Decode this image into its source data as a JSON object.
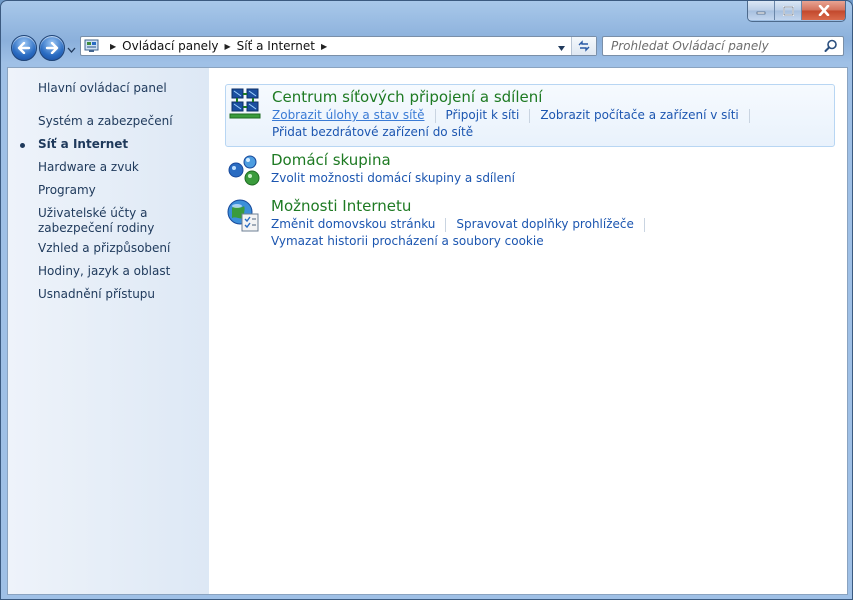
{
  "window": {
    "caption_buttons": [
      "minimize-icon",
      "maximize-icon",
      "close-icon"
    ]
  },
  "navigation": {
    "breadcrumbs": [
      "Ovládací panely",
      "Síť a Internet"
    ],
    "search_placeholder": "Prohledat Ovládací panely"
  },
  "sidebar": {
    "home": "Hlavní ovládací panel",
    "items": [
      "Systém a zabezpečení",
      "Síť a Internet",
      "Hardware a zvuk",
      "Programy",
      "Uživatelské účty a zabezpečení rodiny",
      "Vzhled a přizpůsobení",
      "Hodiny, jazyk a oblast",
      "Usnadnění přístupu"
    ],
    "active_index": 1
  },
  "categories": [
    {
      "title": "Centrum síťových připojení a sdílení",
      "icon": "network-center-icon",
      "links": [
        "Zobrazit úlohy a stav sítě",
        "Připojit k síti",
        "Zobrazit počítače a zařízení v síti",
        "Přidat bezdrátové zařízení do sítě"
      ]
    },
    {
      "title": "Domácí skupina",
      "icon": "homegroup-icon",
      "links": [
        "Zvolit možnosti domácí skupiny a sdílení"
      ]
    },
    {
      "title": "Možnosti Internetu",
      "icon": "internet-options-icon",
      "links": [
        "Změnit domovskou stránku",
        "Spravovat doplňky prohlížeče",
        "Vymazat historii procházení a soubory cookie"
      ]
    }
  ],
  "colors": {
    "accent_link": "#1c56b0",
    "category_title": "#1e7a23",
    "sidebar_text": "#1e395b"
  }
}
